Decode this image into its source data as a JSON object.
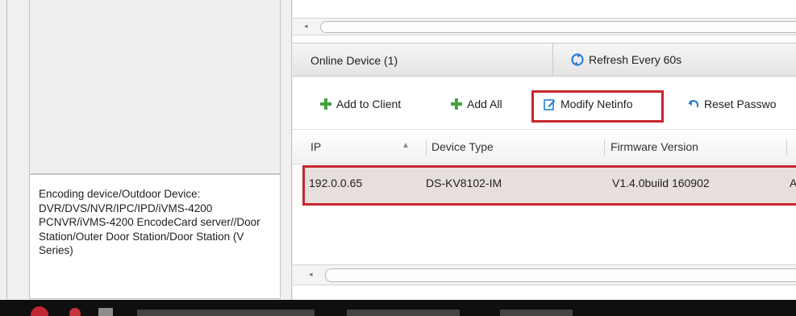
{
  "left_panel": {
    "description": "Encoding device/Outdoor Device: DVR/DVS/NVR/IPC/IPD/iVMS-4200 PCNVR/iVMS-4200 EncodeCard server//Door Station/Outer Door Station/Door Station (V Series)"
  },
  "tabs": {
    "online_device": "Online Device (1)",
    "refresh": "Refresh Every 60s"
  },
  "toolbar": {
    "add_to_client": "Add to Client",
    "add_all": "Add All",
    "modify_netinfo": "Modify Netinfo",
    "reset_password": "Reset Passwo"
  },
  "table": {
    "columns": [
      "IP",
      "Device Type",
      "Firmware Version"
    ],
    "rows": [
      {
        "ip": "192.0.0.65",
        "device_type": "DS-KV8102-IM",
        "firmware": "V1.4.0build 160902",
        "extra": "A"
      }
    ]
  },
  "colors": {
    "accent_green": "#46a23a",
    "accent_blue": "#2a7fd4",
    "highlight_red": "#c8252e",
    "selected_row": "#e6dfdd"
  }
}
